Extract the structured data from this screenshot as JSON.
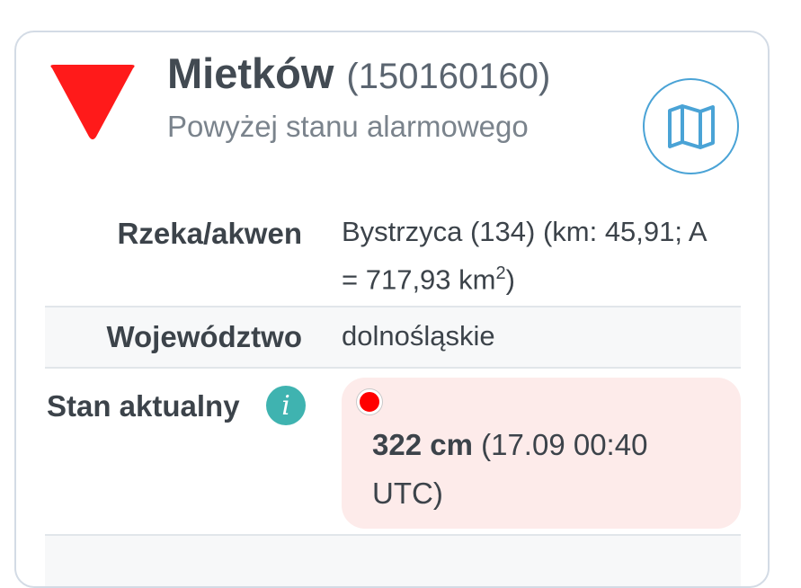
{
  "station": {
    "name": "Mietków",
    "id": "(150160160)",
    "status": "Powyżej stanu alarmowego",
    "status_color": "#ff1a1a"
  },
  "map_button": {
    "icon": "map-icon",
    "color": "#4aa3d6"
  },
  "details": {
    "river_label": "Rzeka/akwen",
    "river_value_line1": "Bystrzyca (134) (km: 45,91; A",
    "river_value_line2_prefix": "= 717,93 km",
    "river_value_sup": "2",
    "river_value_line2_suffix": ")",
    "voivodeship_label": "Województwo",
    "voivodeship_value": "dolnośląskie",
    "current_label": "Stan aktualny",
    "info_icon": "i",
    "current_level": "322 cm",
    "current_time": " (17.09 00:40 UTC)",
    "current_dot_color": "#ff0000"
  }
}
